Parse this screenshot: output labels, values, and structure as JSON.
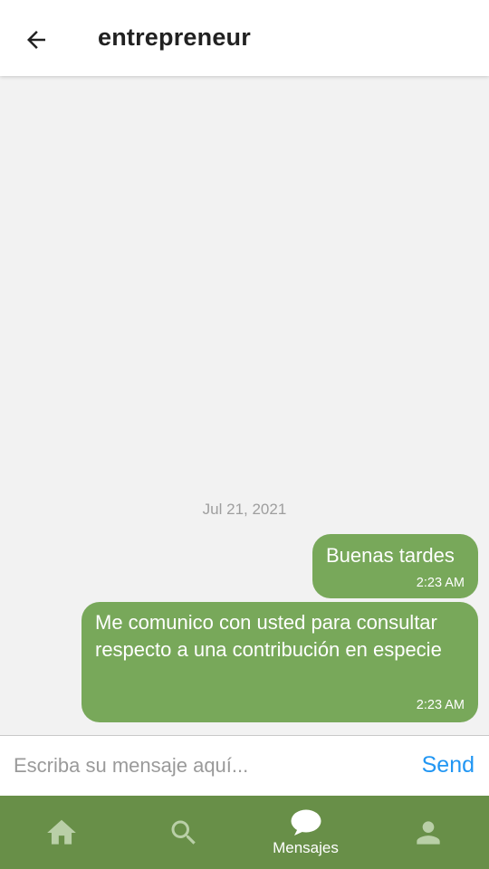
{
  "header": {
    "title": "entrepreneur",
    "back_icon": "arrow-left-icon"
  },
  "chat": {
    "date_divider": "Jul 21, 2021",
    "messages": [
      {
        "text": "Buenas tardes",
        "time": "2:23 AM",
        "sender": "me"
      },
      {
        "text": "Me comunico con usted para consultar respecto a una contribución en especie",
        "time": "2:23 AM",
        "sender": "me"
      }
    ]
  },
  "composer": {
    "placeholder": "Escriba su mensaje aquí...",
    "value": "",
    "send_label": "Send"
  },
  "nav": {
    "items": [
      {
        "icon": "home-icon",
        "label": "",
        "active": false
      },
      {
        "icon": "search-icon",
        "label": "",
        "active": false
      },
      {
        "icon": "chat-bubble-icon",
        "label": "Mensajes",
        "active": true
      },
      {
        "icon": "person-icon",
        "label": "",
        "active": false
      }
    ]
  },
  "colors": {
    "bubble": "#78a85a",
    "nav_background": "#688f48",
    "nav_icon_inactive": "#b9cfa7",
    "send": "#2196f3",
    "chat_background": "#f2f2f2"
  }
}
